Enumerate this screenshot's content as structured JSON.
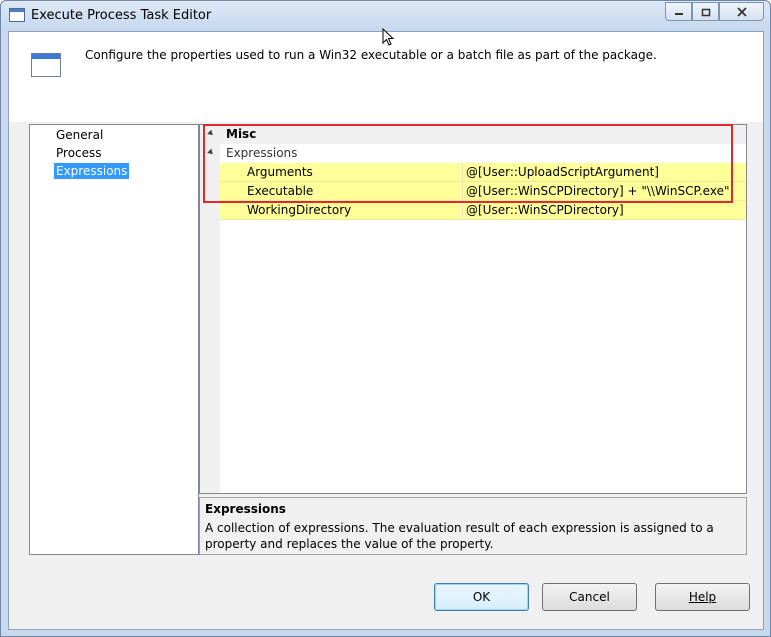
{
  "window": {
    "title": "Execute Process Task Editor",
    "caption_buttons": {
      "minimize": "–",
      "restore": "▫",
      "close": ""
    }
  },
  "header": {
    "description": "Configure the properties used to run a Win32 executable or a batch file as part of the package."
  },
  "nav": {
    "items": [
      {
        "label": "General",
        "selected": false
      },
      {
        "label": "Process",
        "selected": false
      },
      {
        "label": "Expressions",
        "selected": true
      }
    ]
  },
  "grid": {
    "category": "Misc",
    "subcategory": "Expressions",
    "properties": [
      {
        "name": "Arguments",
        "value": "@[User::UploadScriptArgument]"
      },
      {
        "name": "Executable",
        "value": "@[User::WinSCPDirectory] + \"\\\\WinSCP.exe\""
      },
      {
        "name": "WorkingDirectory",
        "value": "@[User::WinSCPDirectory]"
      }
    ]
  },
  "description_panel": {
    "title": "Expressions",
    "text": "A collection of expressions. The evaluation result of each expression is assigned to a property and replaces the value of the property."
  },
  "buttons": {
    "ok": "OK",
    "cancel": "Cancel",
    "help": "Help"
  },
  "colors": {
    "selection": "#3399ff",
    "highlight_border": "#e0292f",
    "property_background": "#ffff99"
  }
}
